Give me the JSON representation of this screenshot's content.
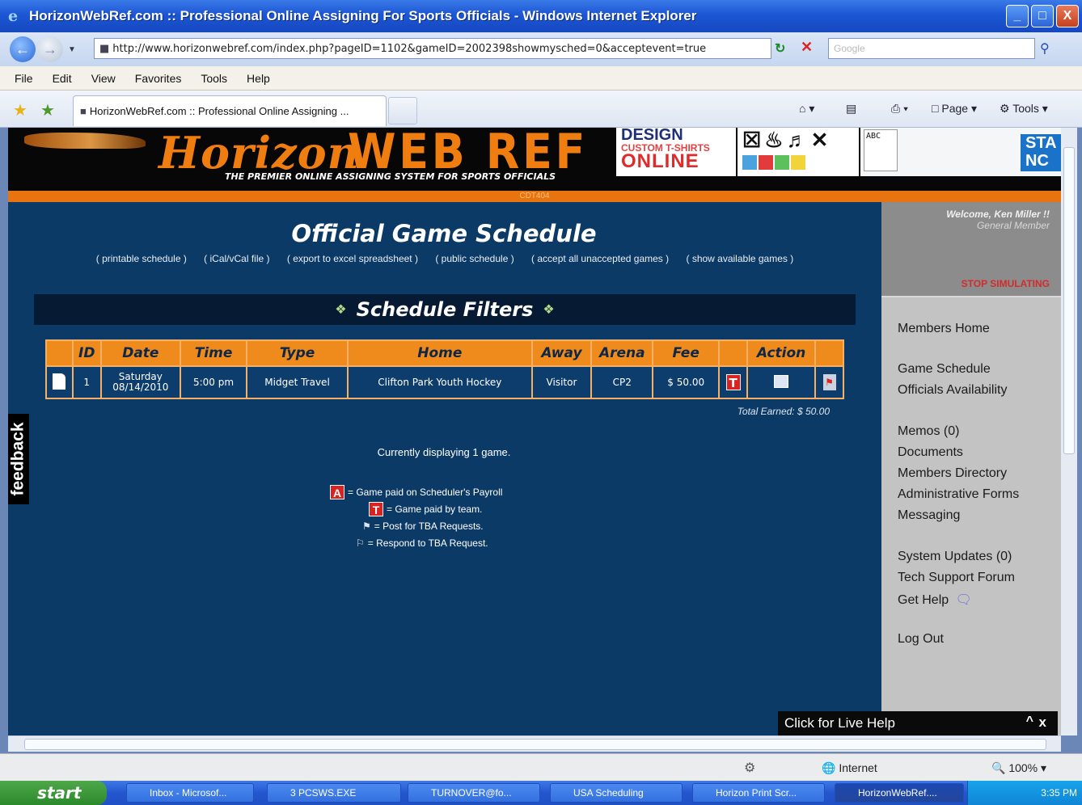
{
  "window": {
    "title": "HorizonWebRef.com :: Professional Online Assigning For Sports Officials - Windows Internet Explorer",
    "minimize": "_",
    "maximize": "□",
    "close": "X"
  },
  "address_bar": {
    "url": "http://www.horizonwebref.com/index.php?pageID=1102&gameID=2002398showmysched=0&acceptevent=true",
    "search_placeholder": "Google"
  },
  "menu": [
    "File",
    "Edit",
    "View",
    "Favorites",
    "Tools",
    "Help"
  ],
  "tab": {
    "label": "HorizonWebRef.com :: Professional Online Assigning ..."
  },
  "command_bar": {
    "page": "Page",
    "tools": "Tools"
  },
  "banner": {
    "logo_script": "Horizon",
    "logo_main": "WEB REF",
    "tagline": "THE PREMIER ONLINE ASSIGNING SYSTEM FOR SPORTS OFFICIALS",
    "ad_line1": "DESIGN",
    "ad_line2": "CUSTOM T-SHIRTS",
    "ad_line3": "ONLINE",
    "ad_right": "STA NC",
    "ad_abc": "ABC",
    "orange_bar_text": "CDT404"
  },
  "page": {
    "title": "Official Game Schedule",
    "links": [
      "( printable schedule )",
      "( iCal/vCal file )",
      "( export to excel spreadsheet )",
      "( public schedule )",
      "( accept all unaccepted games )",
      "( show available games )"
    ],
    "filters_label": "Schedule Filters",
    "table": {
      "headers": [
        "",
        "ID",
        "Date",
        "Time",
        "Type",
        "Home",
        "Away",
        "Arena",
        "Fee",
        "",
        "Action",
        ""
      ],
      "rows": [
        {
          "id": "1",
          "date_line1": "Saturday",
          "date_line2": "08/14/2010",
          "time": "5:00 pm",
          "type": "Midget Travel",
          "home": "Clifton Park Youth Hockey",
          "away": "Visitor",
          "arena": "CP2",
          "fee": "$ 50.00",
          "paid_flag": "T"
        }
      ]
    },
    "total_earned": "Total Earned: $ 50.00",
    "displaying": "Currently displaying 1 game.",
    "legend": [
      {
        "badge": "A",
        "text": "= Game paid on Scheduler's Payroll"
      },
      {
        "badge": "T",
        "text": "= Game paid by team."
      },
      {
        "badge": "post-icon",
        "text": "= Post for TBA Requests."
      },
      {
        "badge": "respond-icon",
        "text": "= Respond to TBA Request."
      }
    ],
    "feedback_tab": "feedback"
  },
  "sidebar": {
    "welcome": "Welcome, Ken Miller !!",
    "role": "General Member",
    "stop_simulating": "STOP SIMULATING",
    "nav": [
      "Members Home",
      "Game Schedule",
      "Officials Availability",
      "Memos (0)",
      "Documents",
      "Members Directory",
      "Administrative Forms",
      "Messaging",
      "System Updates (0)",
      "Tech Support Forum",
      "Get Help",
      "Log Out"
    ]
  },
  "live_help": {
    "label": "Click for Live Help",
    "controls": "^",
    "close": "x"
  },
  "status_bar": {
    "zone": "Internet",
    "zoom": "100%"
  },
  "taskbar": {
    "start": "start",
    "tasks": [
      "Inbox - Microsof...",
      "3 PCSWS.EXE",
      "TURNOVER@fo...",
      "USA Scheduling",
      "Horizon Print Scr...",
      "HorizonWebRef...."
    ],
    "clock": "3:35 PM"
  },
  "colors": {
    "page_bg": "#0c3a66",
    "accent_orange": "#ef8a1c",
    "sidebar_gray": "#c3c3c3",
    "badge_red": "#d92222"
  }
}
